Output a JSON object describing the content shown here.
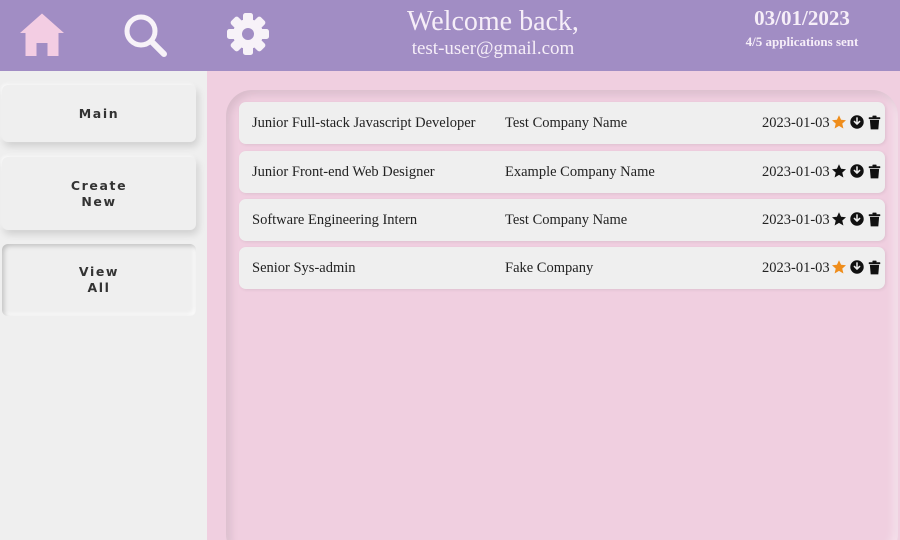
{
  "header": {
    "welcome_title": "Welcome back,",
    "user_email": "test-user@gmail.com",
    "date": "03/01/2023",
    "applications_status": "4/5 applications sent",
    "icons": [
      "home-icon",
      "search-icon",
      "gear-icon"
    ]
  },
  "sidebar": {
    "main_label": "Main",
    "create_label": "Create New",
    "view_all_label": "View All",
    "active_item": "View All"
  },
  "applications": [
    {
      "title": "Junior Full-stack Javascript Developer",
      "company": "Test Company Name",
      "date": "2023-01-03",
      "starred": true
    },
    {
      "title": "Junior Front-end Web Designer",
      "company": "Example Company Name",
      "date": "2023-01-03",
      "starred": false
    },
    {
      "title": "Software Engineering Intern",
      "company": "Test Company Name",
      "date": "2023-01-03",
      "starred": false
    },
    {
      "title": "Senior Sys-admin",
      "company": "Fake Company",
      "date": "2023-01-03",
      "starred": true
    }
  ],
  "colors": {
    "header_bg": "#a18dc4",
    "icon_pink": "#f3cde3",
    "icon_white": "#f7f2f8",
    "page_bg": "#f0cfe0",
    "sidebar_bg": "#efefef",
    "star_on": "#ef8d1b",
    "star_off": "#111111"
  }
}
